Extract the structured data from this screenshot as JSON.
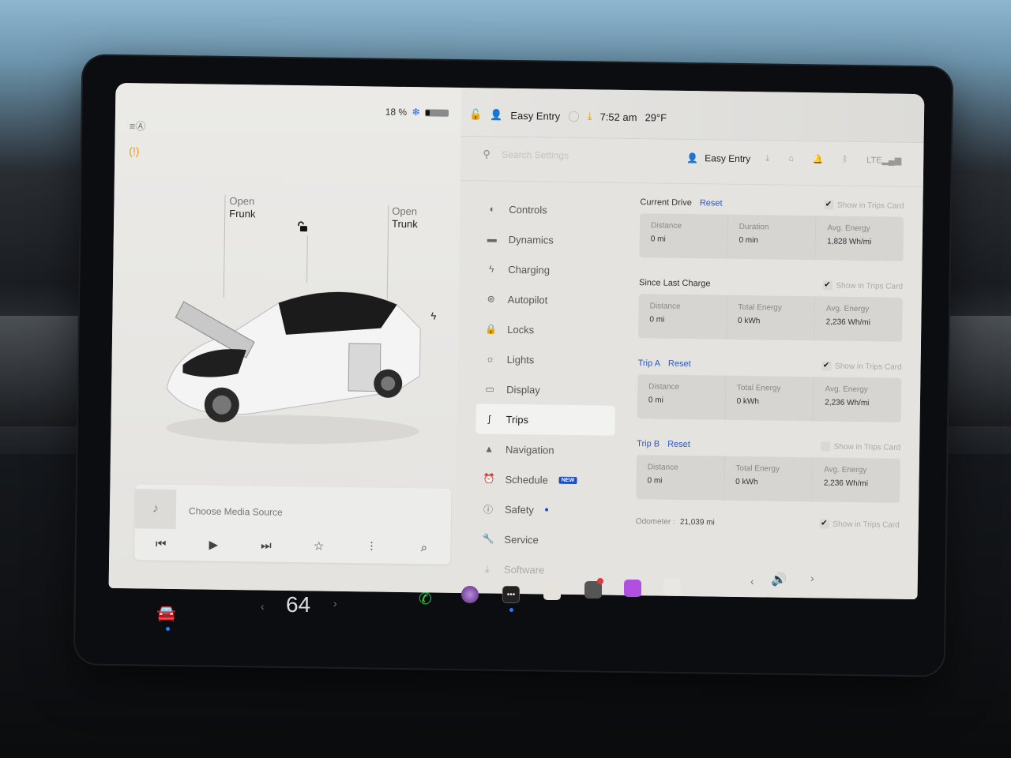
{
  "status": {
    "battery_percent": "18 %",
    "battery_level": 0.18,
    "climate_icon": "snowflake-icon",
    "time": "7:52 am",
    "temperature": "29°F",
    "profile_name": "Easy Entry"
  },
  "car_panel": {
    "frunk": {
      "action": "Open",
      "label": "Frunk"
    },
    "trunk": {
      "action": "Open",
      "label": "Trunk"
    }
  },
  "media": {
    "source_label": "Choose Media Source"
  },
  "settings": {
    "search_placeholder": "Search Settings",
    "profile_name": "Easy Entry",
    "nav": [
      {
        "label": "Controls",
        "icon": "toggle-icon"
      },
      {
        "label": "Dynamics",
        "icon": "car-icon"
      },
      {
        "label": "Charging",
        "icon": "bolt-icon"
      },
      {
        "label": "Autopilot",
        "icon": "steering-wheel-icon"
      },
      {
        "label": "Locks",
        "icon": "lock-icon"
      },
      {
        "label": "Lights",
        "icon": "sun-icon"
      },
      {
        "label": "Display",
        "icon": "display-icon"
      },
      {
        "label": "Trips",
        "icon": "trips-icon",
        "active": true
      },
      {
        "label": "Navigation",
        "icon": "navigation-icon"
      },
      {
        "label": "Schedule",
        "icon": "alarm-icon",
        "badge": "NEW"
      },
      {
        "label": "Safety",
        "icon": "alert-icon",
        "dot": true
      },
      {
        "label": "Service",
        "icon": "wrench-icon"
      },
      {
        "label": "Software",
        "icon": "download-icon"
      }
    ],
    "show_in_trips_card": "Show in Trips Card",
    "reset_label": "Reset",
    "trips": {
      "current_drive": {
        "title": "Current Drive",
        "show_checked": true,
        "cells": [
          {
            "label": "Distance",
            "value": "0 mi"
          },
          {
            "label": "Duration",
            "value": "0 min"
          },
          {
            "label": "Avg. Energy",
            "value": "1,828 Wh/mi"
          }
        ]
      },
      "since_last_charge": {
        "title": "Since Last Charge",
        "show_checked": true,
        "cells": [
          {
            "label": "Distance",
            "value": "0 mi"
          },
          {
            "label": "Total Energy",
            "value": "0 kWh"
          },
          {
            "label": "Avg. Energy",
            "value": "2,236 Wh/mi"
          }
        ]
      },
      "trip_a": {
        "title": "Trip A",
        "show_checked": true,
        "cells": [
          {
            "label": "Distance",
            "value": "0 mi"
          },
          {
            "label": "Total Energy",
            "value": "0 kWh"
          },
          {
            "label": "Avg. Energy",
            "value": "2,236 Wh/mi"
          }
        ]
      },
      "trip_b": {
        "title": "Trip B",
        "show_checked": false,
        "cells": [
          {
            "label": "Distance",
            "value": "0 mi"
          },
          {
            "label": "Total Energy",
            "value": "0 kWh"
          },
          {
            "label": "Avg. Energy",
            "value": "2,236 Wh/mi"
          }
        ]
      },
      "odometer": {
        "label": "Odometer :",
        "value": "21,039 mi",
        "show_checked": true
      }
    }
  },
  "taskbar": {
    "temperature_setting": "64",
    "apps": [
      "phone-icon",
      "camera-icon",
      "more-icon",
      "toybox-icon",
      "dashcam-icon",
      "podcasts-icon",
      "notes-icon"
    ]
  }
}
